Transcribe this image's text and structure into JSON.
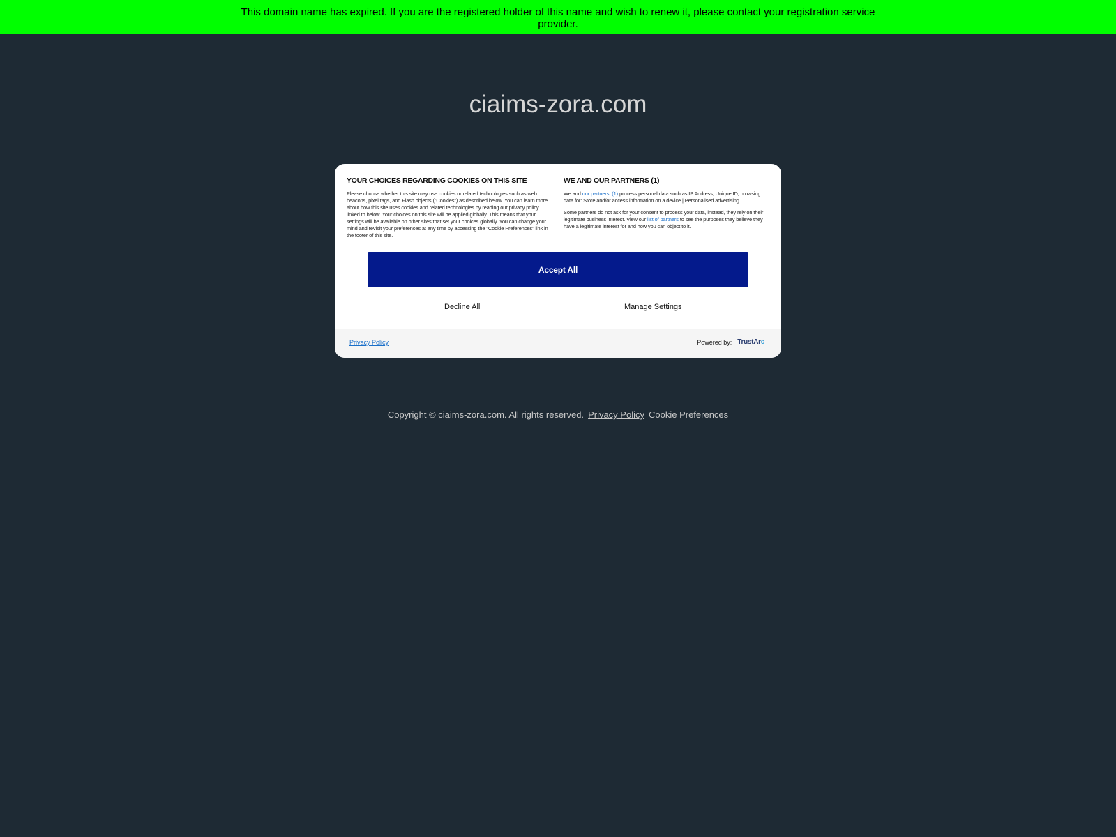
{
  "banner": {
    "text": "This domain name has expired. If you are the registered holder of this name and wish to renew it, please contact your registration service provider."
  },
  "site": {
    "domain": "ciaims-zora.com"
  },
  "cookie_modal": {
    "left_heading": "YOUR CHOICES REGARDING COOKIES ON THIS SITE",
    "left_body": "Please choose whether this site may use cookies or related technologies such as web beacons, pixel tags, and Flash objects (\"Cookies\") as described below. You can learn more about how this site uses cookies and related technologies by reading our privacy policy linked to below. Your choices on this site will be applied globally. This means that your settings will be available on other sites that set your choices globally. You can change your mind and revisit your preferences at any time by accessing the \"Cookie Preferences\" link in the footer of this site.",
    "right_heading": "WE AND OUR PARTNERS (1)",
    "right_p1_pre": "We and ",
    "right_p1_link": "our partners: (1)",
    "right_p1_post": " process personal data such as IP Address, Unique ID, browsing data for: Store and/or access information on a device | Personalised advertising.",
    "right_p2_pre": "Some partners do not ask for your consent to process your data, instead, they rely on their legitimate business interest. View our ",
    "right_p2_link": "list of partners",
    "right_p2_post": " to see the purposes they believe they have a legitimate interest for and how you can object to it.",
    "accept_label": "Accept All",
    "decline_label": "Decline All",
    "manage_label": "Manage Settings",
    "privacy_label": "Privacy Policy",
    "powered_by_label": "Powered by:",
    "logo_text_main": "TrustAr",
    "logo_text_accent": "c",
    "colors": {
      "accept_bg": "#041a8c",
      "link": "#1a6fc9"
    }
  },
  "footer": {
    "copyright": "Copyright © ciaims-zora.com.  All rights reserved.",
    "privacy_label": "Privacy Policy",
    "cookie_label": "Cookie Preferences"
  },
  "colors": {
    "banner_bg": "#00ff00",
    "page_bg": "#1e2a34"
  }
}
